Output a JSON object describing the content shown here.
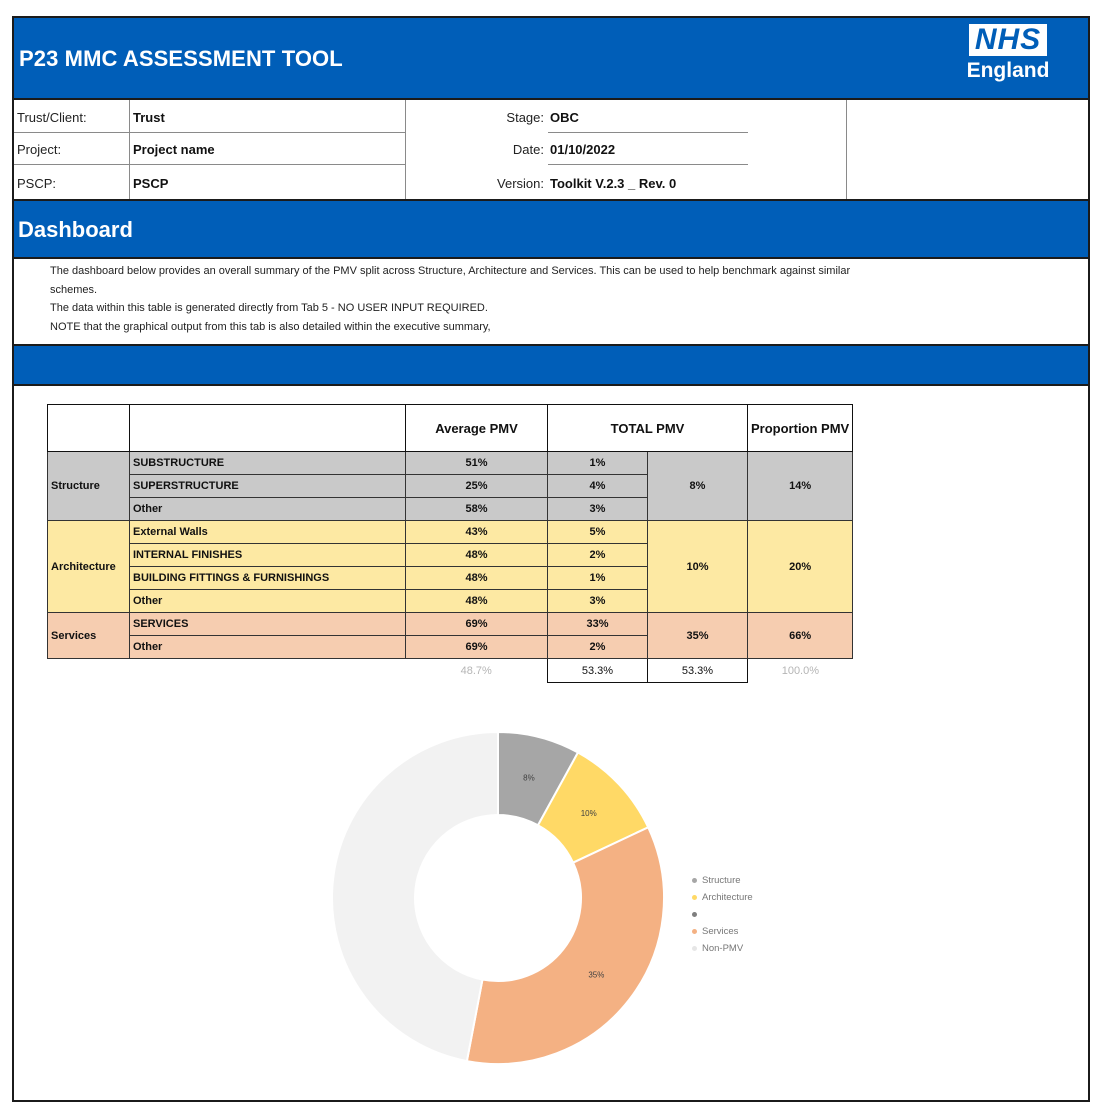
{
  "header": {
    "title": "P23 MMC ASSESSMENT TOOL",
    "logo_text": "NHS",
    "logo_sub": "England"
  },
  "info": {
    "trust_label": "Trust/Client:",
    "trust_value": "Trust",
    "project_label": "Project:",
    "project_value": "Project name",
    "pscp_label": "PSCP:",
    "pscp_value": "PSCP",
    "stage_label": "Stage:",
    "stage_value": "OBC",
    "date_label": "Date:",
    "date_value": "01/10/2022",
    "version_label": "Version:",
    "version_value": "Toolkit V.2.3 _ Rev. 0"
  },
  "dashboard": {
    "title": "Dashboard",
    "description": [
      "The dashboard below provides an overall summary of the PMV split across Structure, Architecture and Services. This can be used to help benchmark against similar",
      "schemes.",
      "The data within this table is generated directly from Tab 5 - NO USER INPUT REQUIRED.",
      "NOTE that the graphical output from this tab is also detailed within the executive summary,"
    ]
  },
  "table": {
    "headers": {
      "avg": "Average PMV",
      "total": "TOTAL PMV",
      "proportion": "Proportion PMV"
    },
    "groups": [
      {
        "name": "Structure",
        "subtotal": "8%",
        "proportion": "14%",
        "rows": [
          {
            "item": "SUBSTRUCTURE",
            "avg": "51%",
            "total": "1%"
          },
          {
            "item": "SUPERSTRUCTURE",
            "avg": "25%",
            "total": "4%"
          },
          {
            "item": "Other",
            "avg": "58%",
            "total": "3%"
          }
        ]
      },
      {
        "name": "Architecture",
        "subtotal": "10%",
        "proportion": "20%",
        "rows": [
          {
            "item": "External Walls",
            "avg": "43%",
            "total": "5%"
          },
          {
            "item": "INTERNAL FINISHES",
            "avg": "48%",
            "total": "2%"
          },
          {
            "item": "BUILDING FITTINGS & FURNISHINGS",
            "avg": "48%",
            "total": "1%"
          },
          {
            "item": "Other",
            "avg": "48%",
            "total": "3%"
          }
        ]
      },
      {
        "name": "Services",
        "subtotal": "35%",
        "proportion": "66%",
        "rows": [
          {
            "item": "SERVICES",
            "avg": "69%",
            "total": "33%"
          },
          {
            "item": "Other",
            "avg": "69%",
            "total": "2%"
          }
        ]
      }
    ],
    "totals": {
      "avg": "48.7%",
      "total": "53.3%",
      "subtotal": "53.3%",
      "proportion": "100.0%"
    }
  },
  "colors": {
    "nhs_blue": "#005EB8",
    "structure": "#A6A6A6",
    "architecture": "#FFD966",
    "services": "#F4B183",
    "non_pmv": "#F2F2F2"
  },
  "chart_data": {
    "type": "pie",
    "subtype": "doughnut",
    "legend_position": "right",
    "slices": [
      {
        "name": "Structure",
        "value": 8,
        "label": "8%",
        "color": "#A6A6A6"
      },
      {
        "name": "Architecture",
        "value": 10,
        "label": "10%",
        "color": "#FFD966"
      },
      {
        "name": "",
        "value": 0,
        "label": "",
        "color": "#7F7F7F"
      },
      {
        "name": "Services",
        "value": 35,
        "label": "35%",
        "color": "#F4B183"
      },
      {
        "name": "Non-PMV",
        "value": 47,
        "label": "",
        "color": "#F2F2F2"
      }
    ]
  }
}
